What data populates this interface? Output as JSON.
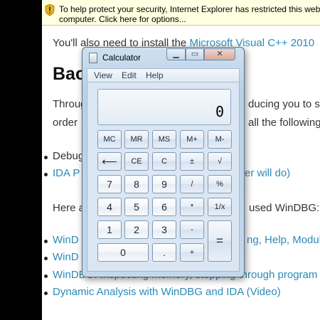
{
  "infobar": {
    "line1": "To help protect your security, Internet Explorer has restricted this webp",
    "line2": "computer. Click here for options..."
  },
  "article": {
    "line_top_prefix": "You'll also need to install the ",
    "line_top_link": "Microsoft Visual C++ 2010",
    "heading": "Bac",
    "p1_start": "Throug",
    "p1_end": "ducing you to so",
    "p2_start": "order",
    "p2_end": "all the following:",
    "bullet1": "Debug",
    "bullet2_start": "IDA P",
    "bullet2_end": "er will do)",
    "p3_start": "Here a",
    "p3_end": "used WinDBG:",
    "link1_start": "WinD",
    "link1_end": "ng, Help, Module",
    "link2_start": "WinD",
    "link3": "WinDBG: Inspecting memory, stepping through program",
    "link4": "Dynamic Analysis with WinDBG and IDA (Video)"
  },
  "calculator": {
    "title": "Calculator",
    "window_buttons": {
      "minimize": "▁",
      "maximize": "▭",
      "close": "✕"
    },
    "menu": [
      "View",
      "Edit",
      "Help"
    ],
    "display": "0",
    "keys": {
      "mc": "MC",
      "mr": "MR",
      "ms": "MS",
      "mplus": "M+",
      "mminus": "M-",
      "back": "⟵",
      "ce": "CE",
      "c": "C",
      "plusminus": "±",
      "sqrt": "√",
      "n7": "7",
      "n8": "8",
      "n9": "9",
      "divide": "/",
      "percent": "%",
      "n4": "4",
      "n5": "5",
      "n6": "6",
      "multiply": "*",
      "reciprocal": "1/x",
      "n1": "1",
      "n2": "2",
      "n3": "3",
      "minus": "-",
      "equals": "=",
      "n0": "0",
      "decimal": ".",
      "plus": "+"
    }
  }
}
